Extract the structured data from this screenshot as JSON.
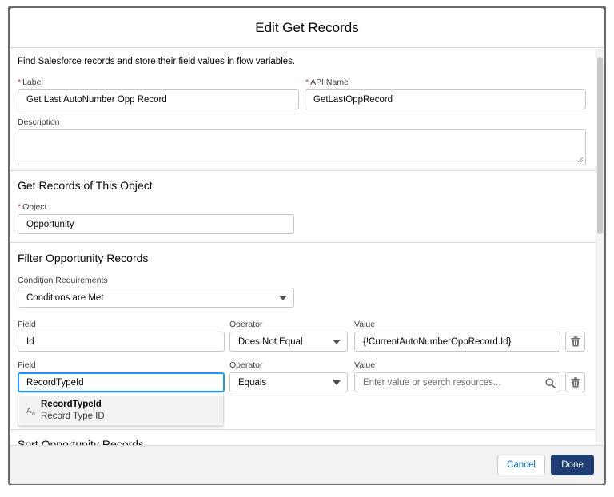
{
  "modal": {
    "title": "Edit Get Records"
  },
  "intro": "Find Salesforce records and store their field values in flow variables.",
  "general": {
    "label_label": "Label",
    "label_value": "Get Last AutoNumber Opp Record",
    "api_name_label": "API Name",
    "api_name_value": "GetLastOppRecord",
    "description_label": "Description",
    "required_marker": "*"
  },
  "object_section": {
    "title": "Get Records of This Object",
    "object_label": "Object",
    "object_value": "Opportunity"
  },
  "filter_section": {
    "title": "Filter Opportunity Records",
    "condition_label": "Condition Requirements",
    "condition_value": "Conditions are Met",
    "rows": [
      {
        "field_label": "Field",
        "field_value": "Id",
        "operator_label": "Operator",
        "operator_value": "Does Not Equal",
        "value_label": "Value",
        "value_value": "{!CurrentAutoNumberOppRecord.Id}"
      },
      {
        "field_label": "Field",
        "field_value": "RecordTypeId",
        "operator_label": "Operator",
        "operator_value": "Equals",
        "value_label": "Value",
        "value_placeholder": "Enter value or search resources..."
      }
    ],
    "dropdown": {
      "icon_text": "A",
      "icon_sub": "a",
      "option_name": "RecordTypeId",
      "option_sub": "Record Type ID"
    }
  },
  "sort_section": {
    "title": "Sort Opportunity Records"
  },
  "footer": {
    "cancel_label": "Cancel",
    "done_label": "Done"
  },
  "colors": {
    "brand": "#1d3d73",
    "link": "#0070d2",
    "focus": "#1b96ff",
    "required": "#c23934"
  },
  "icons": [
    "trash-icon",
    "search-icon",
    "chevron-down-icon",
    "text-field-icon"
  ]
}
